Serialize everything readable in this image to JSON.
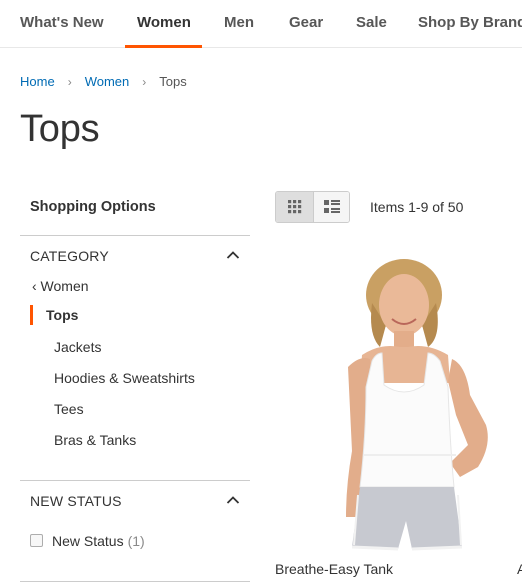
{
  "nav": {
    "items": [
      "What's New",
      "Women",
      "Men",
      "Gear",
      "Sale",
      "Shop By Brand"
    ],
    "active": "Women",
    "accent_color": "#ff5501"
  },
  "breadcrumbs": {
    "items": [
      "Home",
      "Women",
      "Tops"
    ],
    "separator_icon": "chevron-right-icon"
  },
  "page": {
    "title": "Tops"
  },
  "sidebar": {
    "heading": "Shopping Options",
    "category": {
      "title": "CATEGORY",
      "toggle_icon": "chevron-up-icon",
      "back_label": "‹ Women",
      "current": "Tops",
      "subcategories": [
        "Jackets",
        "Hoodies & Sweatshirts",
        "Tees",
        "Bras & Tanks"
      ]
    },
    "new_status": {
      "title": "NEW STATUS",
      "toggle_icon": "chevron-up-icon",
      "option_label": "New Status",
      "option_count": "(1)"
    }
  },
  "toolbar": {
    "view_modes": [
      "grid-icon",
      "list-icon"
    ],
    "active_mode": "grid",
    "items_text": "Items 1-9 of 50"
  },
  "products": [
    {
      "name": "Breathe-Easy Tank"
    }
  ],
  "next_product_partial": "A"
}
